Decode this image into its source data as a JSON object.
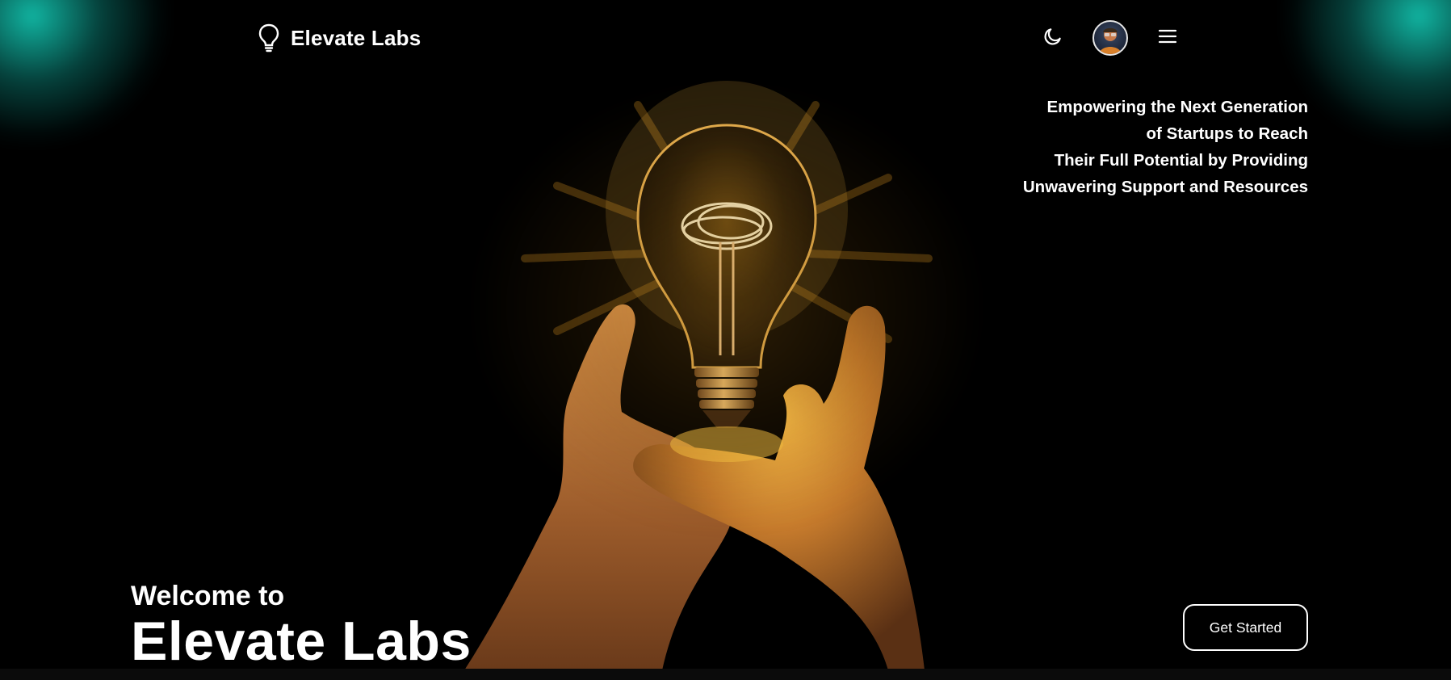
{
  "header": {
    "brand_name": "Elevate Labs",
    "brand_icon": "lightbulb-icon",
    "theme_icon": "moon-icon",
    "menu_icon": "hamburger-menu-icon"
  },
  "hero": {
    "tagline_lines": [
      "Empowering the Next Generation",
      "of Startups to Reach",
      "Their Full Potential by Providing",
      "Unwavering Support and Resources"
    ],
    "welcome_small": "Welcome to",
    "welcome_big": "Elevate Labs",
    "cta_label": "Get Started"
  },
  "colors": {
    "background": "#000000",
    "accent_glow": "#12beaa",
    "bulb_glow": "#f3b443",
    "text": "#ffffff"
  }
}
